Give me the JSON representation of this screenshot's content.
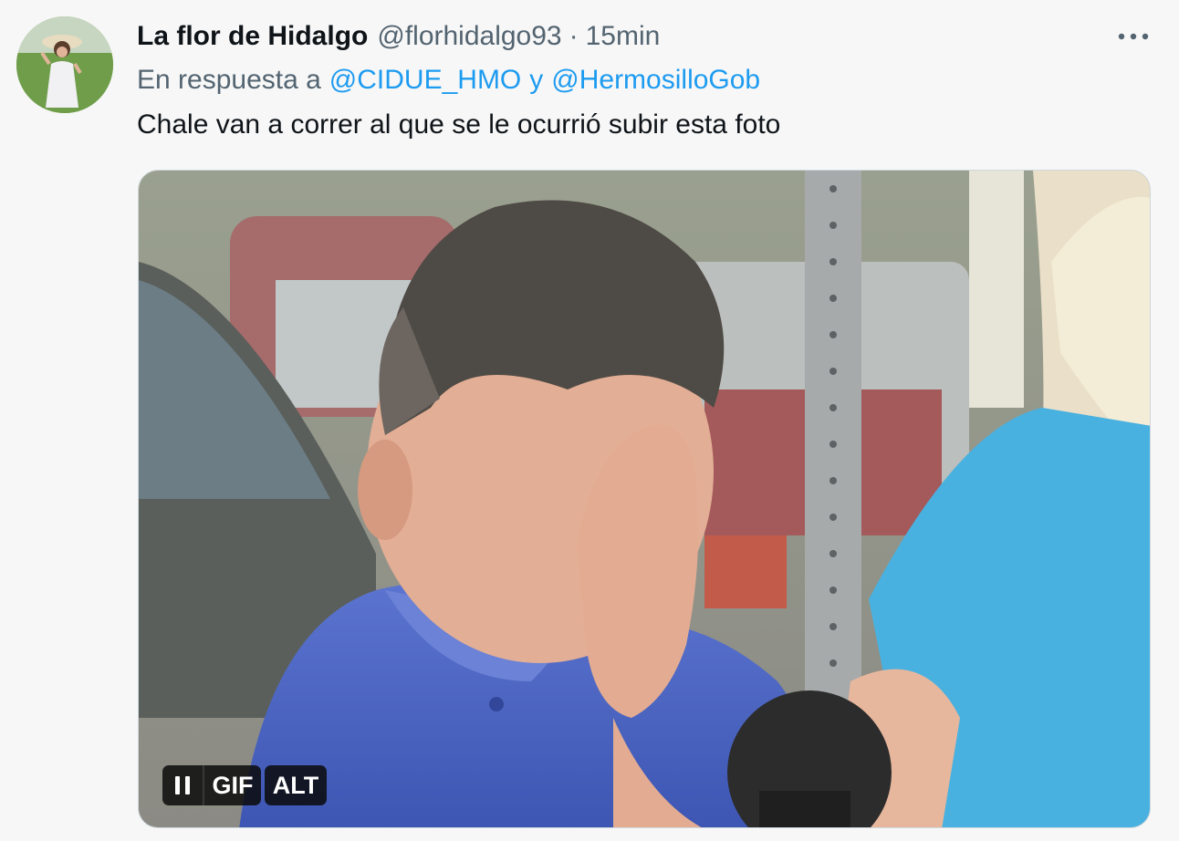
{
  "author": {
    "display_name": "La flor de Hidalgo",
    "handle": "@florhidalgo93",
    "separator": "·",
    "time": "15min",
    "avatar_icon": "avatar-photo"
  },
  "more_icon": "more-dots-icon",
  "reply": {
    "prefix": "En respuesta a",
    "mention_1": "@CIDUE_HMO",
    "joiner": "y",
    "mention_2": "@HermosilloGob"
  },
  "tweet": {
    "text": "Chale van a correr al que se le ocurrió subir esta foto"
  },
  "media": {
    "type": "gif",
    "pause_icon": "pause-icon",
    "gif_label": "GIF",
    "alt_label": "ALT"
  },
  "colors": {
    "link": "#1d9bf0",
    "secondary_text": "#536471",
    "primary_text": "#0f1419",
    "background": "#f7f7f7"
  }
}
